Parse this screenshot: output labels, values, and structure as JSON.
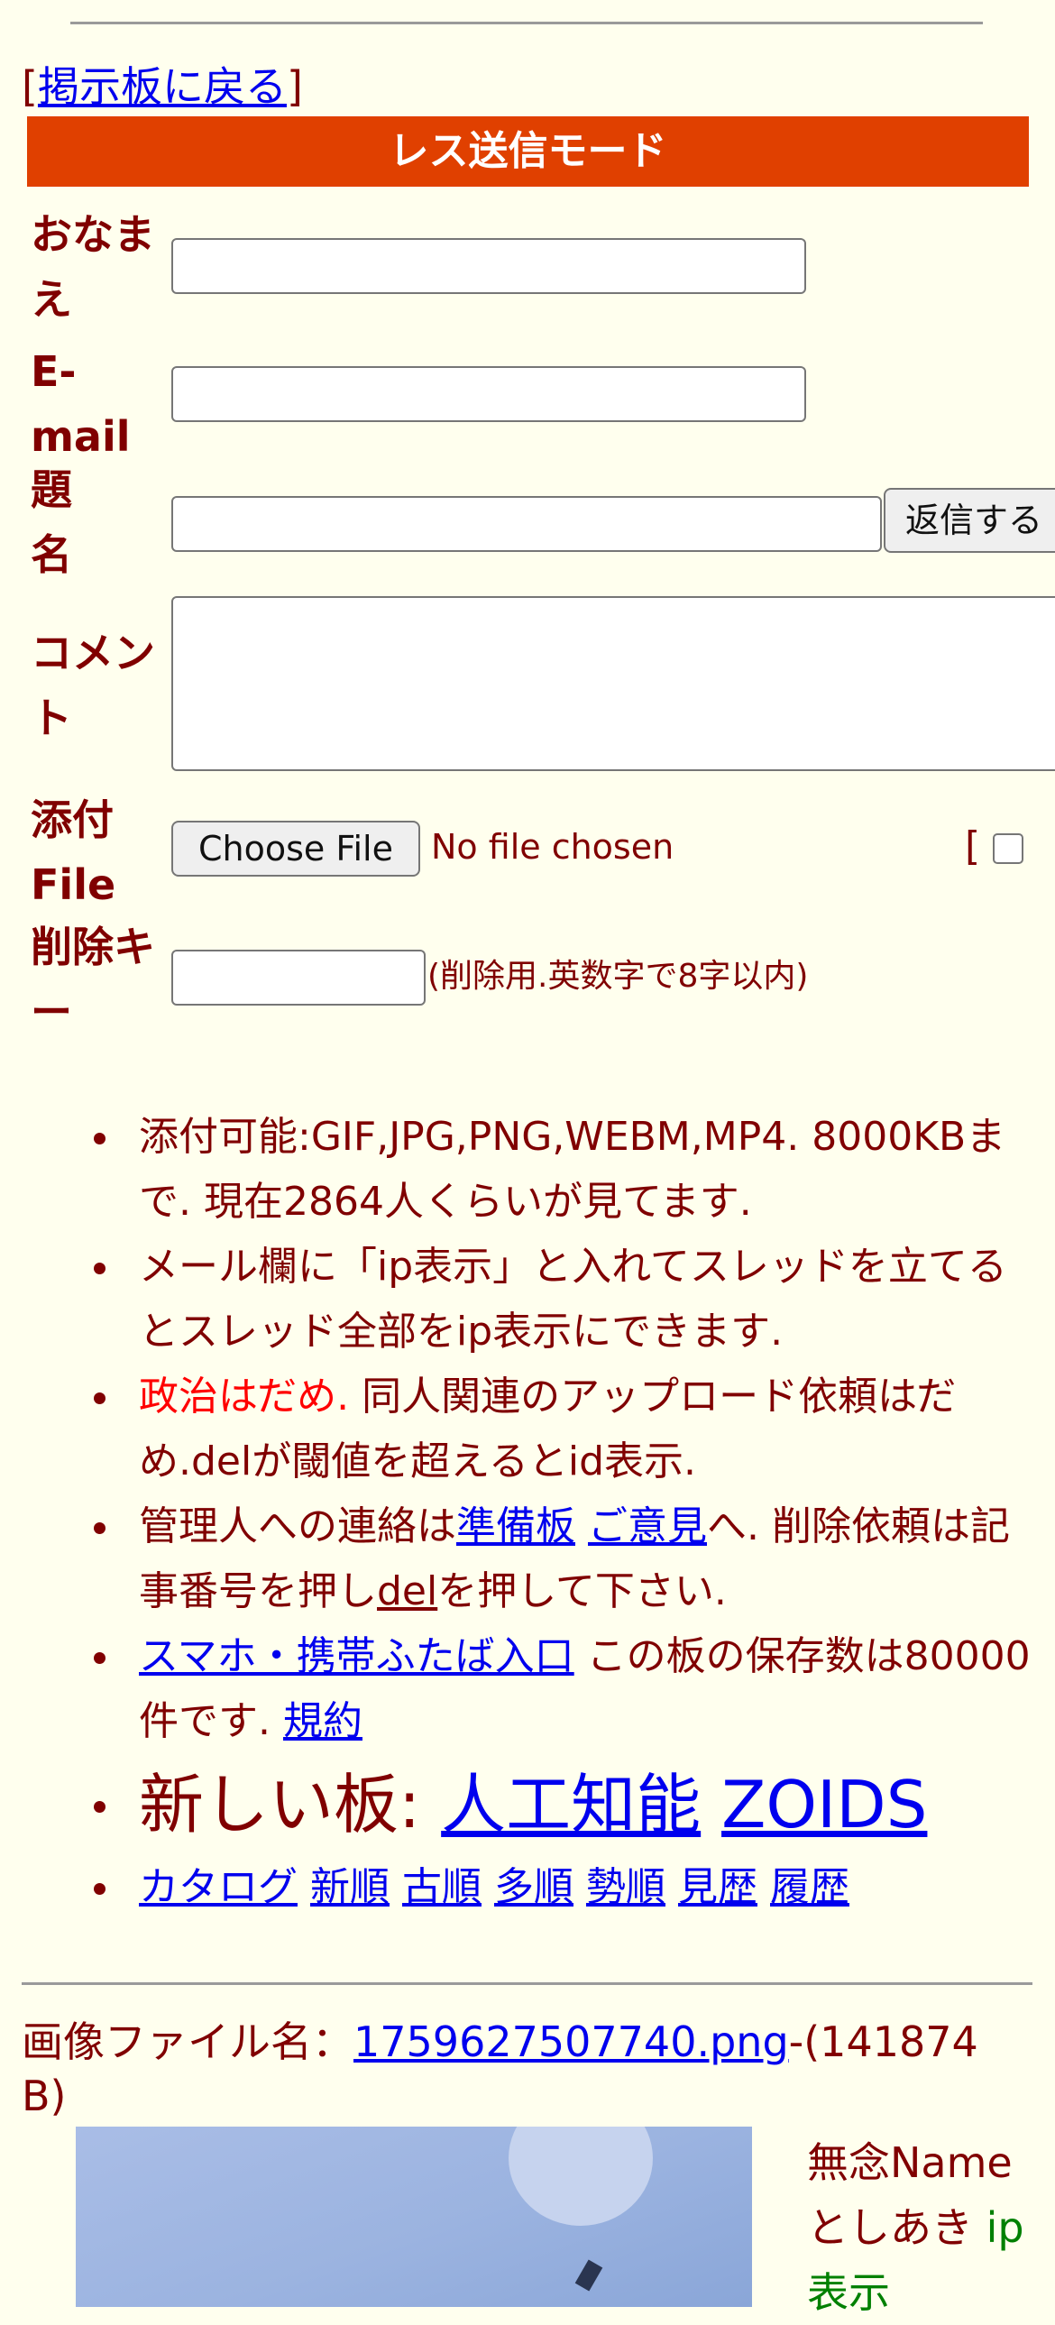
{
  "nav": {
    "back_open": "[",
    "back_link": "掲示板に戻る",
    "back_close": "]"
  },
  "form": {
    "mode_title": "レス送信モード",
    "labels": {
      "name_1": "おなま",
      "name_2": "え",
      "email_1": "E-",
      "email_2": "mail",
      "subject_1": "題",
      "subject_2": "名",
      "comment_1": "コメン",
      "comment_2": "ト",
      "file_1": "添付",
      "file_2": "File",
      "delkey_1": "削除キ",
      "delkey_2": "ー"
    },
    "name_value": "",
    "email_value": "",
    "subject_value": "",
    "comment_value": "",
    "delkey_value": "",
    "submit_label": "返信する",
    "choose_file_label": "Choose File",
    "file_status": "No file chosen",
    "image_checkbox_prefix": "[",
    "image_checkbox_checked": false,
    "delkey_note": "(削除用.英数字で8字以内)"
  },
  "info": {
    "line1": "添付可能:GIF,JPG,PNG,WEBM,MP4. 8000KBまで. 現在2864人くらいが見てます.",
    "line2": "メール欄に「ip表示」と入れてスレッドを立てるとスレッド全部をip表示にできます.",
    "line3_red": "政治はだめ.",
    "line3_rest": " 同人関連のアップロード依頼はだめ.delが閾値を超えるとid表示.",
    "line4_a": "管理人への連絡は",
    "line4_link1": "準備板",
    "line4_link2": "ご意見",
    "line4_b": "へ. 削除依頼は記事番号を押し",
    "line4_link3": "del",
    "line4_c": "を押して下さい.",
    "line5_link": "スマホ・携帯ふたば入口",
    "line5_text": " この板の保存数は80000件です. ",
    "line5_link2": "規約",
    "line6_prefix": "新しい板: ",
    "line6_link1": "人工知能",
    "line6_link2": "ZOIDS",
    "line7_links": [
      "カタログ",
      "新順",
      "古順",
      "多順",
      "勢順",
      "見歴",
      "履歴"
    ]
  },
  "post": {
    "file_prefix": "画像ファイル名：",
    "file_link": "1759627507740.png",
    "file_suffix": "-(141874 B)",
    "name": "無念Name",
    "author": "としあき",
    "ip_label": "ip",
    "ip_label2": "表示"
  },
  "colors": {
    "background": "#ffffee",
    "text": "#800000",
    "mode_bar": "#e04000",
    "link": "#0000ee",
    "warning": "#ff0000",
    "ip": "#008000"
  }
}
